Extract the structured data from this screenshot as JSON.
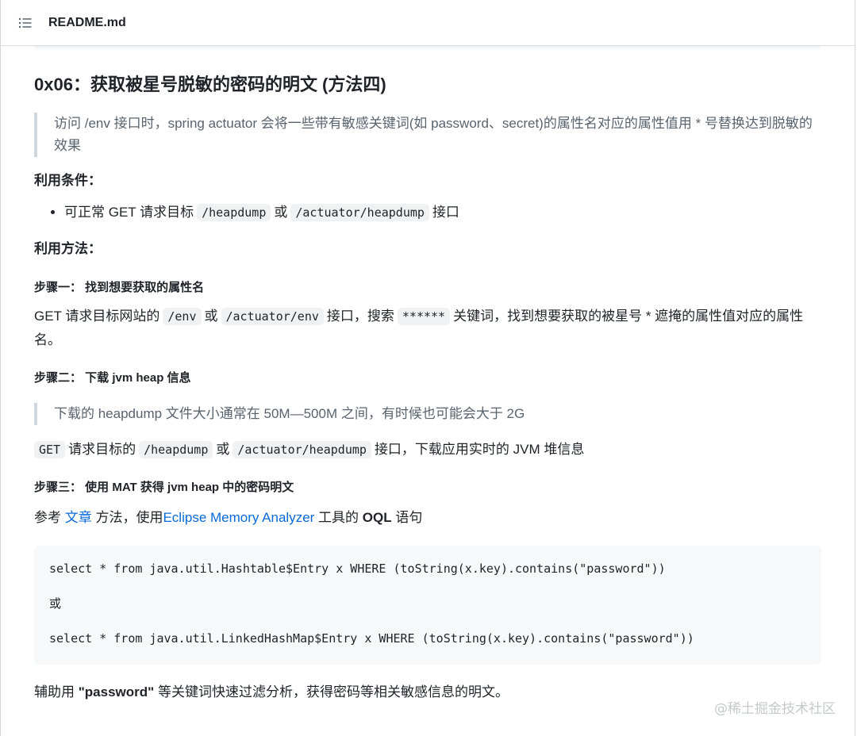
{
  "header": {
    "title": "README.md"
  },
  "section": {
    "title": "0x06：获取被星号脱敏的密码的明文 (方法四)",
    "quote1": "访问 /env 接口时，spring actuator 会将一些带有敏感关键词(如 password、secret)的属性名对应的属性值用 * 号替换达到脱敏的效果",
    "conditions_label": "利用条件：",
    "condition_item": {
      "prefix": "可正常 GET 请求目标",
      "code1": "/heapdump",
      "or": "或",
      "code2": "/actuator/heapdump",
      "suffix": "接口"
    },
    "method_label": "利用方法：",
    "step1": {
      "title": "步骤一： 找到想要获取的属性名",
      "text_prefix": "GET 请求目标网站的",
      "code1": "/env",
      "or": "或",
      "code2": "/actuator/env",
      "mid": "接口，搜索",
      "code3": "******",
      "suffix": "关键词，找到想要获取的被星号 * 遮掩的属性值对应的属性名。"
    },
    "step2": {
      "title": "步骤二： 下载 jvm heap 信息",
      "quote": "下载的 heapdump 文件大小通常在 50M—500M 之间，有时候也可能会大于 2G",
      "code0": "GET",
      "text_prefix": "请求目标的",
      "code1": "/heapdump",
      "or": "或",
      "code2": "/actuator/heapdump",
      "suffix": "接口，下载应用实时的 JVM 堆信息"
    },
    "step3": {
      "title": "步骤三： 使用 MAT 获得 jvm heap 中的密码明文",
      "ref_prefix": "参考",
      "link1": "文章",
      "ref_mid": "方法，使用",
      "link2": "Eclipse Memory Analyzer",
      "ref_mid2": "工具的",
      "bold": "OQL",
      "ref_suffix": "语句"
    },
    "code_block": {
      "line1": "select * from java.util.Hashtable$Entry x WHERE (toString(x.key).contains(\"password\"))",
      "line2": "或",
      "line3": "select * from java.util.LinkedHashMap$Entry x WHERE (toString(x.key).contains(\"password\"))"
    },
    "final": {
      "prefix": "辅助用",
      "bold": "\"password\"",
      "suffix": "等关键词快速过滤分析，获得密码等相关敏感信息的明文。"
    }
  },
  "watermark": "@稀土掘金技术社区"
}
